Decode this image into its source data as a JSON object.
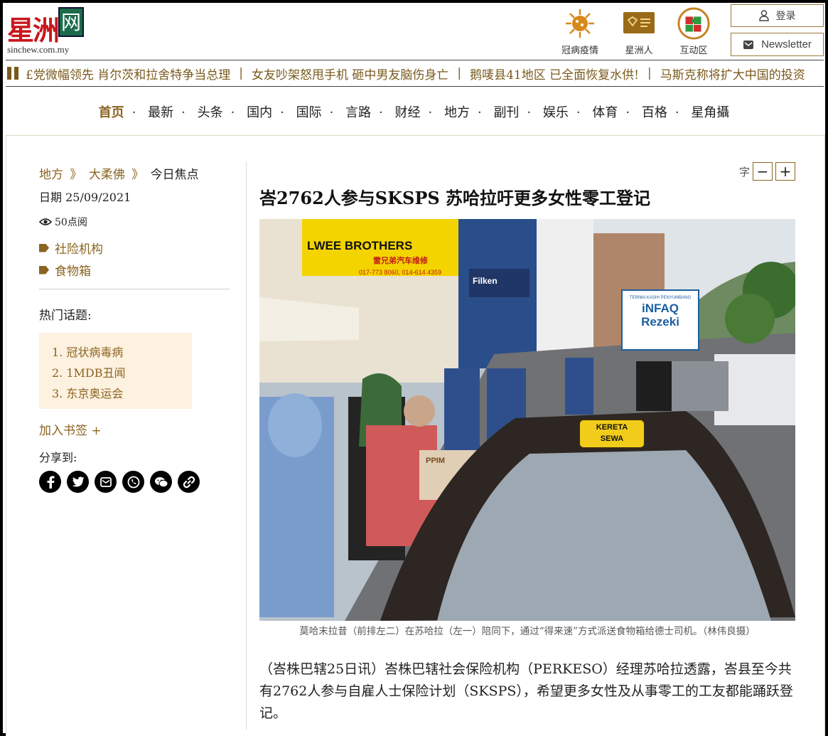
{
  "header": {
    "logo_cn": "星洲",
    "logo_box": "网",
    "logo_en": "sinchew.com.my",
    "icons": [
      {
        "label": "冠病疫情",
        "icon": "virus-icon"
      },
      {
        "label": "星洲人",
        "icon": "card-icon"
      },
      {
        "label": "互动区",
        "icon": "puzzle-icon"
      }
    ],
    "login_label": "登录",
    "newsletter_label": "Newsletter"
  },
  "ticker": {
    "items": [
      "£党微幅领先 肖尔茨和拉舍特争当总理",
      "女友吵架怒甩手机 砸中男友脑伤身亡",
      "鹅唛县41地区 已全面恢复水供!",
      "马斯克称将扩大中国的投资"
    ]
  },
  "nav": {
    "items": [
      "首页",
      "最新",
      "头条",
      "国内",
      "国际",
      "言路",
      "财经",
      "地方",
      "副刊",
      "娱乐",
      "体育",
      "百格",
      "星角攝"
    ]
  },
  "sidebar": {
    "crumbs": [
      "地方",
      "大柔佛",
      "今日焦点"
    ],
    "crumb_sep": "》",
    "date": "日期 25/09/2021",
    "views": "50点阅",
    "tags": [
      "社险机构",
      "食物箱"
    ],
    "hot_title": "热门话题:",
    "hot_topics": [
      "1. 冠状病毒病",
      "2. 1MDB丑闻",
      "3. 东京奥运会"
    ],
    "bookmark": "加入书签 +",
    "share_label": "分享到:",
    "share_icons": [
      "facebook-icon",
      "twitter-icon",
      "email-icon",
      "whatsapp-icon",
      "wechat-icon",
      "link-icon"
    ]
  },
  "article": {
    "font_label": "字",
    "font_minus": "−",
    "font_plus": "+",
    "headline": "峇2762人参与SKSPS 苏哈拉吁更多女性零工登记",
    "photo_texts": {
      "shop_sign": "LWEE BROTHERS",
      "shop_sign_cn": "雷兄弟汽车维修",
      "shop_phone": "017-773 8060, 014-614 4359",
      "placard_top": "TERIMA KASIH PENYUMBANG",
      "placard_line1": "iNFAQ",
      "placard_line2": "Rezeki",
      "taxi_sign1": "KERETA",
      "taxi_sign2": "SEWA",
      "box_label": "PPIM",
      "filken": "Filken"
    },
    "caption": "莫哈末拉昔（前排左二）在苏哈拉（左一）陪同下，通过“得来速”方式派送食物箱给德士司机。（林伟良摄）",
    "body": "（峇株巴辖25日讯）峇株巴辖社会保险机构（PERKESO）经理苏哈拉透露，峇县至今共有2762人参与自雇人士保险计划（SKSPS），希望更多女性及从事零工的工友都能踊跃登记。"
  }
}
